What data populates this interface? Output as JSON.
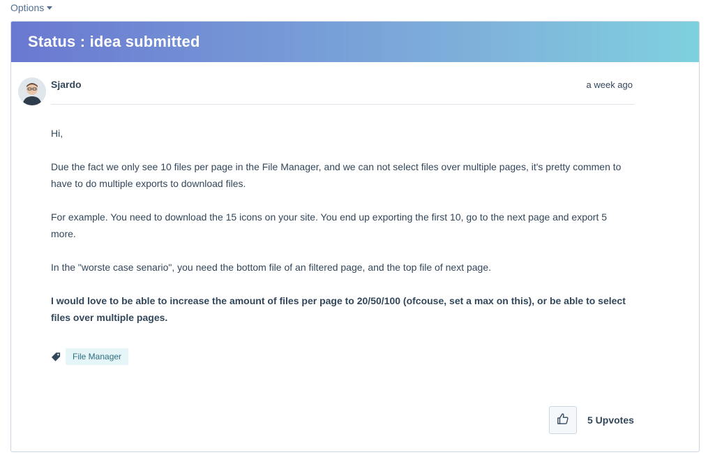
{
  "options": {
    "label": "Options",
    "icon": "chevron-down-icon"
  },
  "banner": {
    "title": "Status : idea submitted"
  },
  "post": {
    "author": "Sjardo",
    "timestamp": "a week ago",
    "paragraphs": [
      "Hi,",
      "Due the fact we only see 10 files per page in the File Manager, and we can not select files over multiple pages, it's pretty commen to have to do multiple exports to download files.",
      "For example. You need to download the 15 icons on your site. You end up exporting the first 10, go to the next page and export 5 more.",
      "In the \"worste case senario\", you need the bottom file of an filtered page, and the top file of next page.",
      "I would love to be able to increase the amount of files per page to 20/50/100 (ofcouse, set a max on this), or be able to select files over multiple pages."
    ],
    "tag_icon": "tag-icon",
    "tags": [
      "File Manager"
    ]
  },
  "votes": {
    "icon": "thumbs-up-icon",
    "label": "5 Upvotes"
  },
  "colors": {
    "banner_start": "#6a78d1",
    "banner_end": "#7fd1de",
    "text": "#33475b",
    "tag_bg": "#e5f5f8"
  }
}
